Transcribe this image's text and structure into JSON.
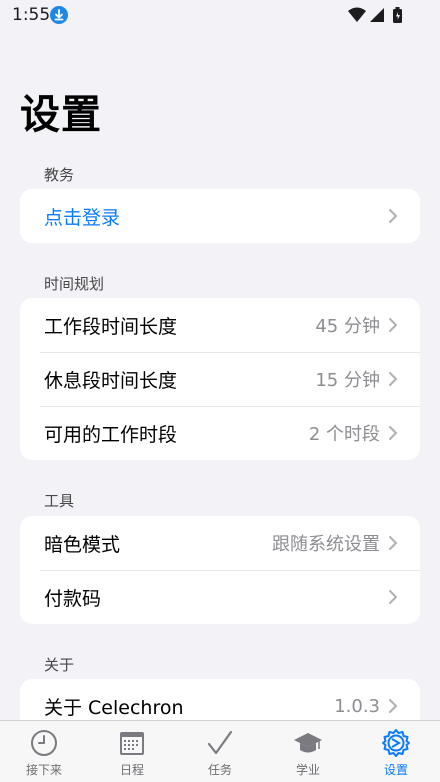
{
  "status_bar": {
    "time": "1:55"
  },
  "page_title": "设置",
  "sections": {
    "academic": {
      "label": "教务",
      "rows": [
        {
          "label": "点击登录"
        }
      ]
    },
    "time_planning": {
      "label": "时间规划",
      "rows": [
        {
          "label": "工作段时间长度",
          "value": "45 分钟"
        },
        {
          "label": "休息段时间长度",
          "value": "15 分钟"
        },
        {
          "label": "可用的工作时段",
          "value": "2 个时段"
        }
      ]
    },
    "tools": {
      "label": "工具",
      "rows": [
        {
          "label": "暗色模式",
          "value": "跟随系统设置"
        },
        {
          "label": "付款码"
        }
      ]
    },
    "about": {
      "label": "关于",
      "rows": [
        {
          "label": "关于 Celechron",
          "value": "1.0.3"
        }
      ]
    }
  },
  "tab_bar": {
    "tabs": [
      {
        "label": "接下来",
        "icon": "clock-icon"
      },
      {
        "label": "日程",
        "icon": "calendar-icon"
      },
      {
        "label": "任务",
        "icon": "checkmark-icon"
      },
      {
        "label": "学业",
        "icon": "graduation-cap-icon"
      },
      {
        "label": "设置",
        "icon": "gear-icon"
      }
    ],
    "active_index": 4
  },
  "colors": {
    "accent": "#0a7aff",
    "background": "#f2f2f7",
    "card": "#ffffff",
    "secondary_text": "#8e8e93"
  }
}
